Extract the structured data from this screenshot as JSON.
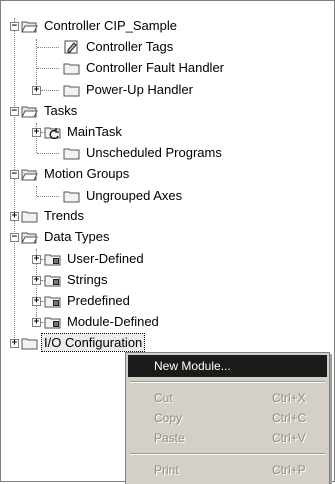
{
  "tree": {
    "root": "Controller CIP_Sample",
    "controller_tags": "Controller Tags",
    "controller_fault_handler": "Controller Fault Handler",
    "power_up_handler": "Power-Up Handler",
    "tasks": "Tasks",
    "main_task": "MainTask",
    "unscheduled_programs": "Unscheduled Programs",
    "motion_groups": "Motion Groups",
    "ungrouped_axes": "Ungrouped Axes",
    "trends": "Trends",
    "data_types": "Data Types",
    "user_defined": "User-Defined",
    "strings": "Strings",
    "predefined": "Predefined",
    "module_defined": "Module-Defined",
    "io_configuration": "I/O Configuration"
  },
  "context_menu": {
    "new_module": "New Module...",
    "cut": "Cut",
    "cut_shortcut": "Ctrl+X",
    "copy": "Copy",
    "copy_shortcut": "Ctrl+C",
    "paste": "Paste",
    "paste_shortcut": "Ctrl+V",
    "print": "Print",
    "print_shortcut": "Ctrl+P"
  }
}
